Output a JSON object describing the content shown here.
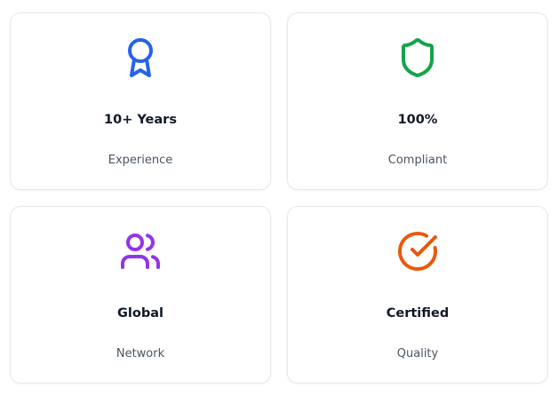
{
  "colors": {
    "award": "#2563eb",
    "shield": "#16a34a",
    "users": "#9333ea",
    "check": "#ea580c"
  },
  "cards": [
    {
      "icon": "award-icon",
      "value": "10+ Years",
      "label": "Experience"
    },
    {
      "icon": "shield-icon",
      "value": "100%",
      "label": "Compliant"
    },
    {
      "icon": "users-icon",
      "value": "Global",
      "label": "Network"
    },
    {
      "icon": "check-circle-icon",
      "value": "Certified",
      "label": "Quality"
    }
  ]
}
